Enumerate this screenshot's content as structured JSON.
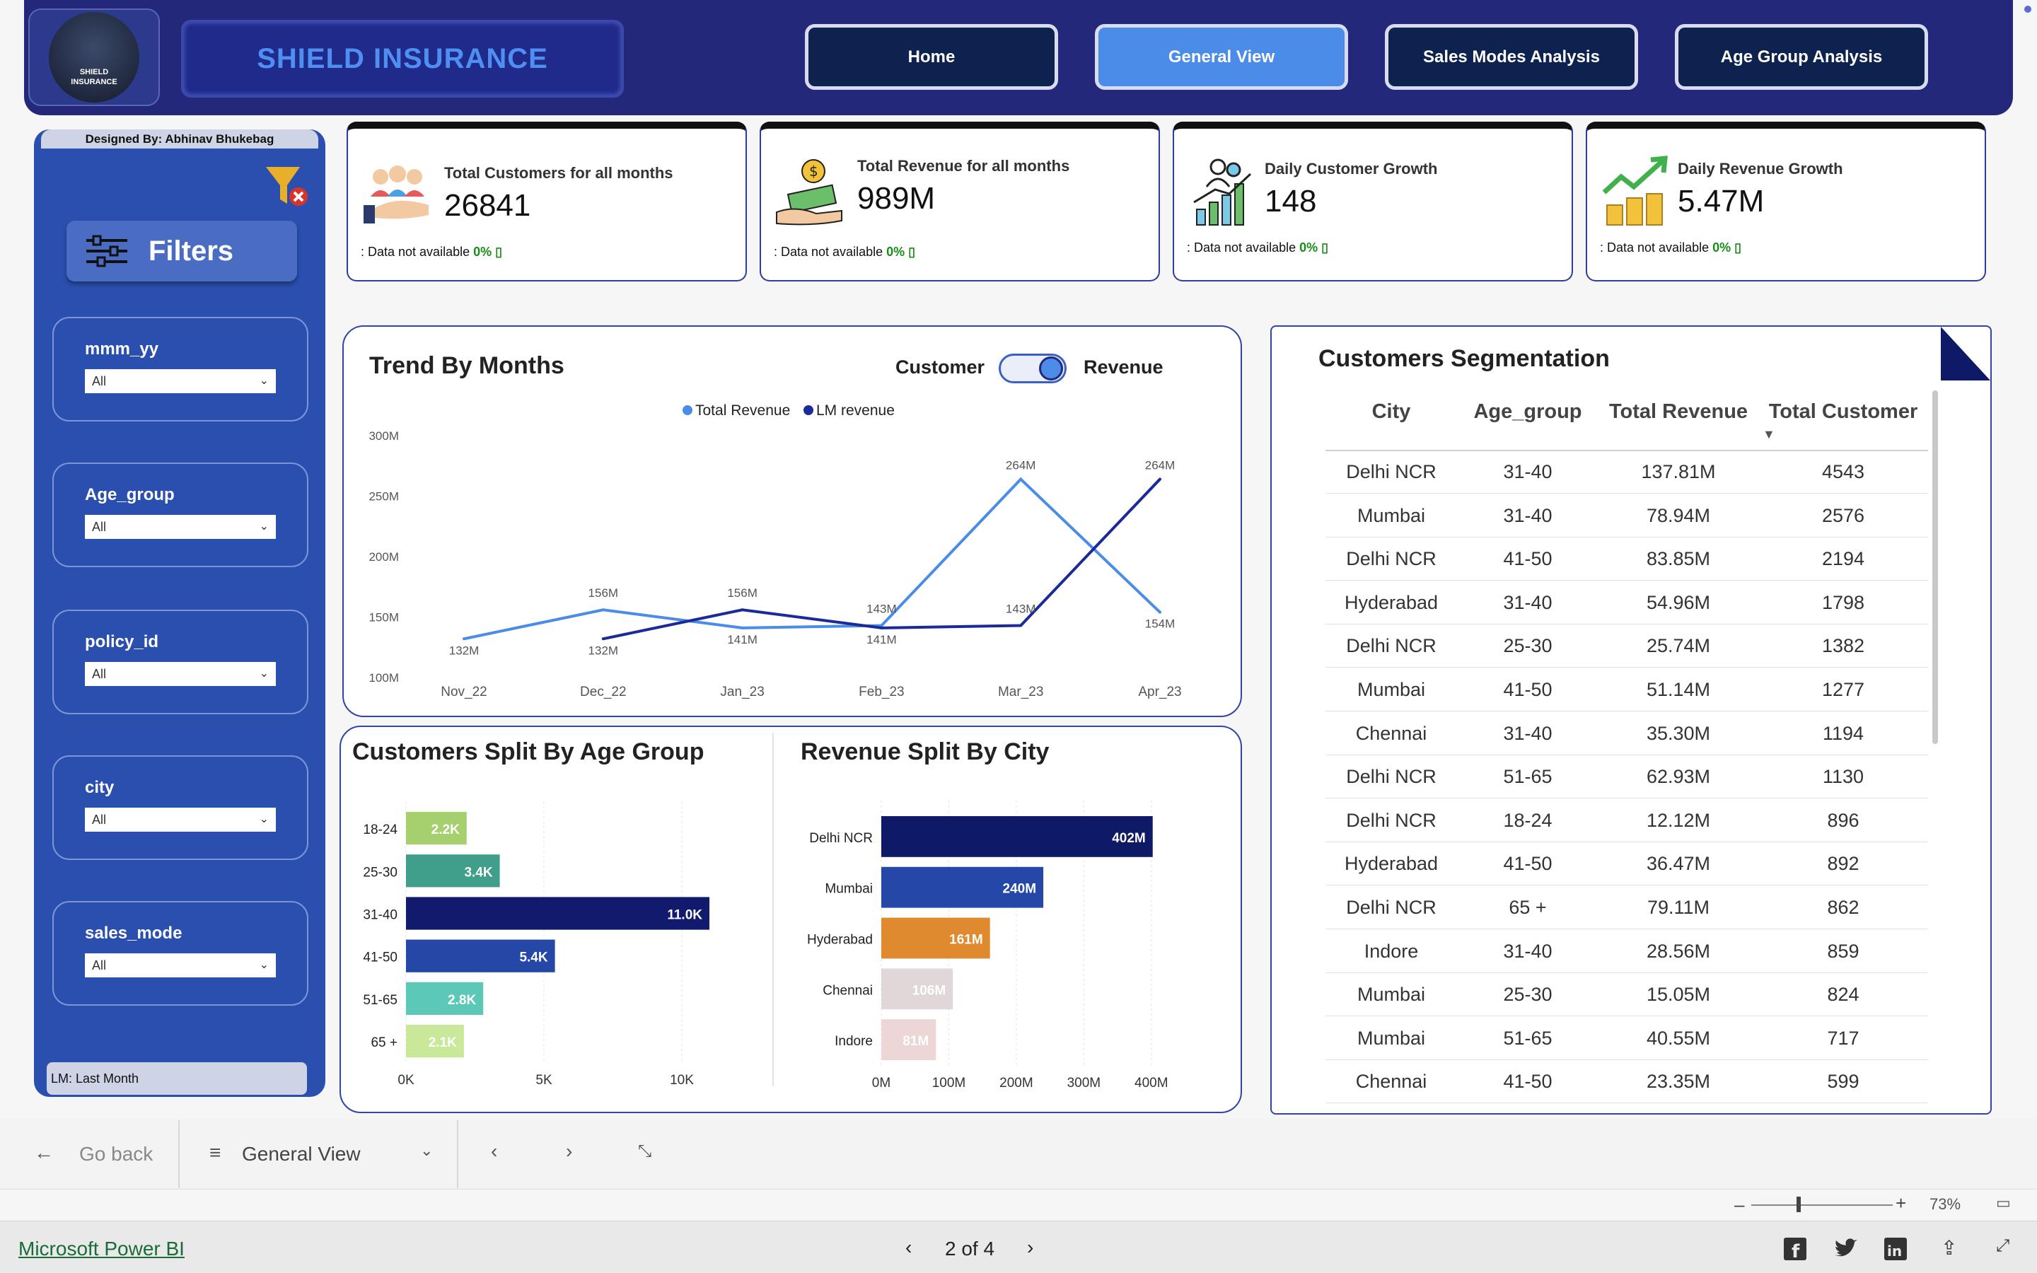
{
  "header": {
    "logo_text": "SHIELD INSURANCE",
    "brand_title": "SHIELD INSURANCE",
    "nav": [
      "Home",
      "General View",
      "Sales Modes Analysis",
      "Age Group Analysis"
    ],
    "active_nav": "General View"
  },
  "sidebar": {
    "designed_by": "Designed By: Abhinav Bhukebag",
    "filters_label": "Filters",
    "slicers": [
      {
        "label": "mmm_yy",
        "value": "All"
      },
      {
        "label": "Age_group",
        "value": "All"
      },
      {
        "label": "policy_id",
        "value": "All"
      },
      {
        "label": "city",
        "value": "All"
      },
      {
        "label": "sales_mode",
        "value": "All"
      }
    ],
    "note": "LM: Last Month"
  },
  "kpis": [
    {
      "title": "Total Customers for all months",
      "value": "26841",
      "note": ": Data not available",
      "pct": "0%",
      "icon": "customers-icon"
    },
    {
      "title": "Total Revenue for all months",
      "value": "989M",
      "note": ": Data not available",
      "pct": "0%",
      "icon": "revenue-icon"
    },
    {
      "title": "Daily Customer Growth",
      "value": "148",
      "note": ": Data not available",
      "pct": "0%",
      "icon": "customer-growth-icon"
    },
    {
      "title": "Daily Revenue Growth",
      "value": "5.47M",
      "note": ": Data not available",
      "pct": "0%",
      "icon": "revenue-growth-icon"
    }
  ],
  "trend": {
    "title": "Trend By Months",
    "toggle_left": "Customer",
    "toggle_right": "Revenue"
  },
  "age_title": "Customers Split By Age Group",
  "city_title": "Revenue Split By City",
  "segmentation": {
    "title": "Customers Segmentation",
    "columns": [
      "City",
      "Age_group",
      "Total Revenue",
      "Total Customer"
    ],
    "rows": [
      [
        "Delhi NCR",
        "31-40",
        "137.81M",
        "4543"
      ],
      [
        "Mumbai",
        "31-40",
        "78.94M",
        "2576"
      ],
      [
        "Delhi NCR",
        "41-50",
        "83.85M",
        "2194"
      ],
      [
        "Hyderabad",
        "31-40",
        "54.96M",
        "1798"
      ],
      [
        "Delhi NCR",
        "25-30",
        "25.74M",
        "1382"
      ],
      [
        "Mumbai",
        "41-50",
        "51.14M",
        "1277"
      ],
      [
        "Chennai",
        "31-40",
        "35.30M",
        "1194"
      ],
      [
        "Delhi NCR",
        "51-65",
        "62.93M",
        "1130"
      ],
      [
        "Delhi NCR",
        "18-24",
        "12.12M",
        "896"
      ],
      [
        "Hyderabad",
        "41-50",
        "36.47M",
        "892"
      ],
      [
        "Delhi NCR",
        "65 +",
        "79.11M",
        "862"
      ],
      [
        "Indore",
        "31-40",
        "28.56M",
        "859"
      ],
      [
        "Mumbai",
        "25-30",
        "15.05M",
        "824"
      ],
      [
        "Mumbai",
        "51-65",
        "40.55M",
        "717"
      ],
      [
        "Chennai",
        "41-50",
        "23.35M",
        "599"
      ]
    ]
  },
  "footer": {
    "go_back": "Go back",
    "page_name": "General View",
    "zoom": "73%",
    "powerbi_link": "Microsoft Power BI",
    "pager": "2 of 4"
  },
  "colors": {
    "header": "#23287a",
    "sidebar": "#2a4fae",
    "accent": "#4a8ce8",
    "navy": "#0e1a66"
  },
  "chart_data": [
    {
      "type": "line",
      "categories": [
        "Nov_22",
        "Dec_22",
        "Jan_23",
        "Feb_23",
        "Mar_23",
        "Apr_23"
      ],
      "series": [
        {
          "name": "Total Revenue",
          "color": "#4a8ce8",
          "values": [
            132,
            156,
            141,
            143,
            264,
            154
          ],
          "labels": [
            "132M",
            "156M",
            "141M",
            "143M",
            "264M",
            "154M"
          ]
        },
        {
          "name": "LM revenue",
          "color": "#1a2a99",
          "values": [
            null,
            132,
            156,
            141,
            143,
            264
          ],
          "labels": [
            "",
            "132M",
            "156M",
            "141M",
            "143M",
            "264M"
          ]
        }
      ],
      "yticks": [
        "100M",
        "150M",
        "200M",
        "250M",
        "300M"
      ],
      "ylim": [
        100,
        300
      ],
      "legend": "top-center"
    },
    {
      "type": "bar",
      "orientation": "horizontal",
      "categories": [
        "18-24",
        "25-30",
        "31-40",
        "41-50",
        "51-65",
        "65 +"
      ],
      "values": [
        2200,
        3400,
        11000,
        5400,
        2800,
        2100
      ],
      "labels": [
        "2.2K",
        "3.4K",
        "11.0K",
        "5.4K",
        "2.8K",
        "2.1K"
      ],
      "colors": [
        "#a6cf6e",
        "#3f9f8a",
        "#121a6e",
        "#2447a8",
        "#5cc9b8",
        "#c9e89a"
      ],
      "label_colors": [
        "#ffffff",
        "#ffffff",
        "#ffffff",
        "#ffffff",
        "#ffffff",
        "#ffffff"
      ],
      "xticks": [
        "0K",
        "5K",
        "10K"
      ],
      "xlim": [
        0,
        12000
      ]
    },
    {
      "type": "bar",
      "orientation": "horizontal",
      "categories": [
        "Delhi NCR",
        "Mumbai",
        "Hyderabad",
        "Chennai",
        "Indore"
      ],
      "values": [
        402,
        240,
        161,
        106,
        81
      ],
      "labels": [
        "402M",
        "240M",
        "161M",
        "106M",
        "81M"
      ],
      "colors": [
        "#0e1a66",
        "#2447a8",
        "#e08a30",
        "#e0d8d8",
        "#ecd6d6"
      ],
      "xticks": [
        "0M",
        "100M",
        "200M",
        "300M",
        "400M"
      ],
      "xlim": [
        0,
        440
      ]
    }
  ]
}
